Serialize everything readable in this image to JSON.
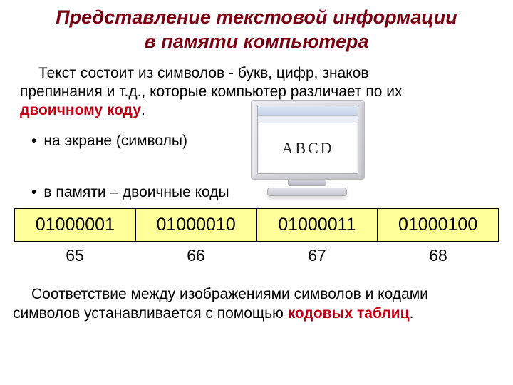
{
  "title_line1": "Представление текстовой информации",
  "title_line2": "в памяти компьютера",
  "para1_a": "Текст состоит из символов - букв, цифр, знаков",
  "para1_b": "препинания и  т.д.,  которые компьютер различает по их",
  "para1_binary": "двоичному коду",
  "bullet1": "на экране (символы)",
  "bullet2": "в памяти – двоичные коды",
  "screen_text": "ABCD",
  "codes": [
    "01000001",
    "01000010",
    "01000011",
    "01000100"
  ],
  "nums": [
    "65",
    "66",
    "67",
    "68"
  ],
  "para2_a": "Соответствие между изображениями символов и кодами",
  "para2_b": "символов устанавливается с помощью ",
  "para2_kodov": "кодовых таблиц",
  "dot": "•",
  "period": "."
}
